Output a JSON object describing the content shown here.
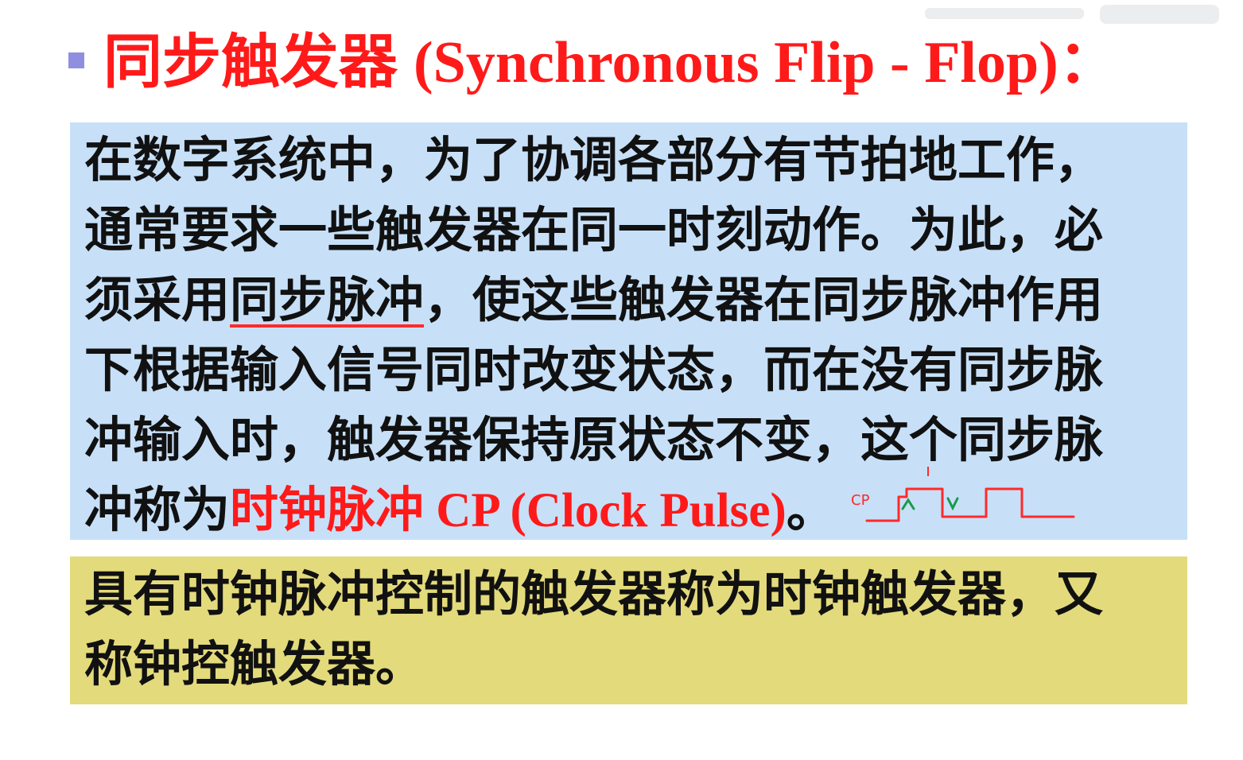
{
  "title": {
    "cn": "同步触发器",
    "en": "(Synchronous Flip - Flop)："
  },
  "para1": {
    "lines": [
      "在数字系统中，为了协调各部分有节拍地工作，",
      "通常要求一些触发器在同一时刻动作。为此，必",
      "须采用",
      "同步脉冲",
      "，使这些触发器在同步脉冲作用",
      "下根据输入信号同时改变状态，而在没有同步脉",
      "冲输入时，触发器保持原状态不变，这个同步脉",
      "冲称为",
      "时钟脉冲",
      " CP (Clock Pulse)",
      "。"
    ]
  },
  "para2": {
    "lines": [
      "具有时钟脉冲控制的触发器称为时钟触发器，又",
      "称钟控触发器。"
    ]
  },
  "annotation": {
    "handwritten": "CP"
  },
  "colors": {
    "title_red": "#ff1a1a",
    "blue_panel": "#c7e0f8",
    "yellow_panel": "#e3da7c",
    "bullet": "#8f8fe0"
  }
}
